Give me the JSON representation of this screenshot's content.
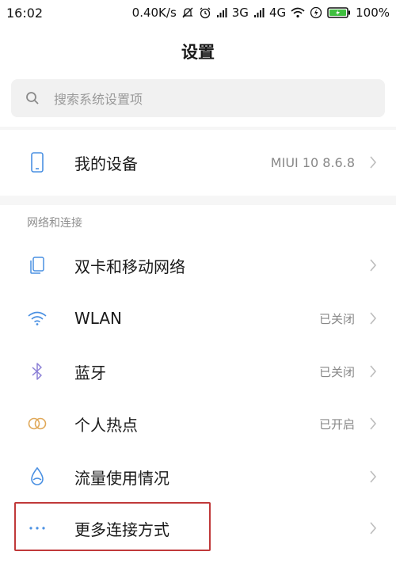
{
  "status_bar": {
    "time": "16:02",
    "speed": "0.40K/s",
    "net1": "3G",
    "net2": "4G",
    "battery": "100%"
  },
  "header": {
    "title": "设置"
  },
  "search": {
    "placeholder": "搜索系统设置项"
  },
  "device": {
    "label": "我的设备",
    "value": "MIUI 10 8.6.8"
  },
  "network_section": {
    "header": "网络和连接",
    "items": [
      {
        "label": "双卡和移动网络",
        "value": "",
        "icon": "sim-card-icon"
      },
      {
        "label": "WLAN",
        "value": "已关闭",
        "icon": "wifi-icon"
      },
      {
        "label": "蓝牙",
        "value": "已关闭",
        "icon": "bluetooth-icon"
      },
      {
        "label": "个人热点",
        "value": "已开启",
        "icon": "hotspot-icon"
      },
      {
        "label": "流量使用情况",
        "value": "",
        "icon": "data-usage-icon"
      },
      {
        "label": "更多连接方式",
        "value": "",
        "icon": "more-dots-icon"
      }
    ]
  },
  "colors": {
    "accent": "#4a90e2",
    "highlight": "#c0393a",
    "secondary_text": "#888888"
  }
}
